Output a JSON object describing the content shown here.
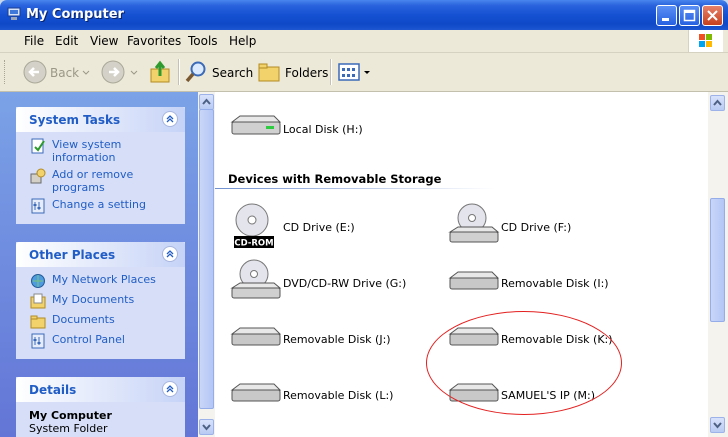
{
  "window": {
    "title": "My Computer",
    "title_icon": "my-computer-icon",
    "controls": [
      "minimize-icon",
      "maximize-icon",
      "close-icon"
    ]
  },
  "menu": {
    "items": [
      "File",
      "Edit",
      "View",
      "Favorites",
      "Tools",
      "Help"
    ]
  },
  "toolbar": {
    "back_label": "Back",
    "search_label": "Search",
    "folders_label": "Folders"
  },
  "left_pane": {
    "system_tasks": {
      "title": "System Tasks",
      "items": [
        {
          "label": "View system information",
          "icon": "system-info-icon"
        },
        {
          "label": "Add or remove programs",
          "icon": "add-remove-programs-icon"
        },
        {
          "label": "Change a setting",
          "icon": "control-panel-icon"
        }
      ]
    },
    "other_places": {
      "title": "Other Places",
      "items": [
        {
          "label": "My Network Places",
          "icon": "network-places-icon"
        },
        {
          "label": "My Documents",
          "icon": "my-documents-icon"
        },
        {
          "label": "Documents",
          "icon": "folder-icon"
        },
        {
          "label": "Control Panel",
          "icon": "control-panel-icon"
        }
      ]
    },
    "details": {
      "title": "Details",
      "name": "My Computer",
      "type": "System Folder"
    }
  },
  "main": {
    "top_drive": {
      "label": "Local Disk (H:)",
      "icon": "hard-disk-icon"
    },
    "group_title": "Devices with Removable Storage",
    "drives": [
      {
        "label": "CD Drive (E:)",
        "icon": "cd-rom-icon",
        "badge": "CD-ROM"
      },
      {
        "label": "CD Drive (F:)",
        "icon": "cd-drive-icon"
      },
      {
        "label": "DVD/CD-RW Drive (G:)",
        "icon": "dvd-drive-icon"
      },
      {
        "label": "Removable Disk (I:)",
        "icon": "removable-disk-icon"
      },
      {
        "label": "Removable Disk (J:)",
        "icon": "removable-disk-icon"
      },
      {
        "label": "Removable Disk (K:)",
        "icon": "removable-disk-icon"
      },
      {
        "label": "Removable Disk (L:)",
        "icon": "removable-disk-icon"
      },
      {
        "label": "SAMUEL'S IP (M:)",
        "icon": "removable-disk-icon"
      }
    ]
  },
  "colors": {
    "title_bar": "#1451d2",
    "panel_link": "#215dc6",
    "annotation": "#e32020"
  }
}
